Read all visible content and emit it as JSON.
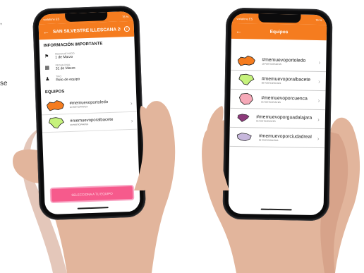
{
  "left_edge": {
    "fragment1": ",",
    "fragment2": "se"
  },
  "phone1": {
    "status": {
      "carrier": "vodafone ES",
      "time": "11:44",
      "battery": "76 %"
    },
    "appbar": {
      "title": "SAN SILVESTRE ILLESCANA 20...",
      "back_icon": "arrow-back-icon",
      "info_icon": "info-icon"
    },
    "important_title": "INFORMACIÓN IMPORTANTE",
    "info": [
      {
        "icon": "flag-icon",
        "label": "FECHA DE INICIO",
        "value": "1 de Marzo"
      },
      {
        "icon": "calendar-icon",
        "label": "FECHA FINAL",
        "value": "31 de Marzo"
      },
      {
        "icon": "person-icon",
        "label": "TIPO",
        "value": "Reto de equipo"
      }
    ],
    "teams_title": "EQUIPOS",
    "teams": [
      {
        "name": "#memuevoportoledo",
        "count": "10 PARTICIPANTES",
        "color": "#f57c1f"
      },
      {
        "name": "#memuevoporalbacete",
        "count": "09 PARTICIPANTES",
        "color": "#c6f27c"
      }
    ],
    "button_label": "SELECCIONA A TU EQUIPO"
  },
  "phone2": {
    "status": {
      "carrier": "vodafone ES",
      "time": "11:44",
      "battery": "76 %"
    },
    "appbar": {
      "title": "Equipos",
      "back_icon": "arrow-back-icon"
    },
    "teams": [
      {
        "name": "#memuevoportoledo",
        "count": "10 PARTICIPANTES",
        "color": "#f57c1f"
      },
      {
        "name": "#memuevoporalbacete",
        "count": "09 PARTICIPANTES",
        "color": "#c6f27c"
      },
      {
        "name": "#memuevoporcuenca",
        "count": "05 PARTICIPANTES",
        "color": "#f6a9b8"
      },
      {
        "name": "#memuevoporguadalajara",
        "count": "05 PARTICIPANTES",
        "color": "#8c3a7a"
      },
      {
        "name": "#memuevoporciudadreal",
        "count": "09 PARTICIPANTES",
        "color": "#c7b7dc"
      }
    ]
  }
}
